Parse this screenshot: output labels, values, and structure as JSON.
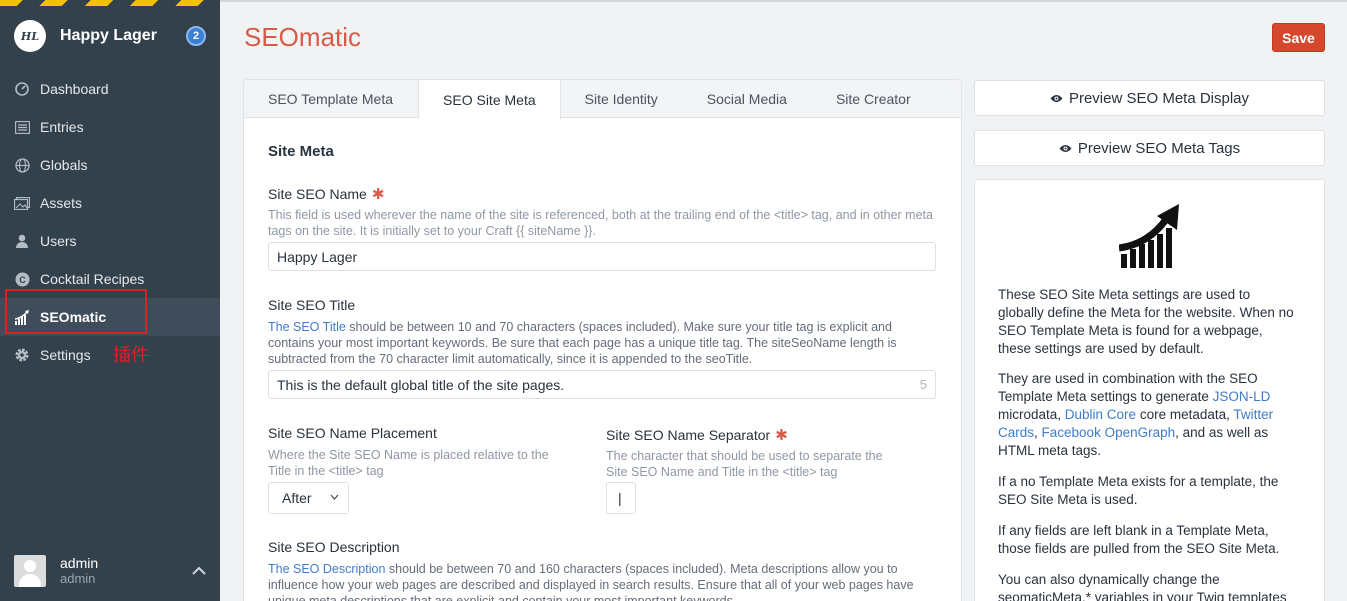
{
  "sidebar": {
    "site_logo": "HL",
    "site_name": "Happy Lager",
    "badge": "2",
    "items": [
      {
        "label": "Dashboard",
        "icon": "dashboard-icon"
      },
      {
        "label": "Entries",
        "icon": "entries-icon"
      },
      {
        "label": "Globals",
        "icon": "globe-icon"
      },
      {
        "label": "Assets",
        "icon": "assets-icon"
      },
      {
        "label": "Users",
        "icon": "users-icon"
      },
      {
        "label": "Cocktail Recipes",
        "icon": "plugin-c-icon"
      },
      {
        "label": "SEOmatic",
        "icon": "seomatic-chart-icon",
        "active": true
      },
      {
        "label": "Settings",
        "icon": "gear-icon"
      }
    ],
    "annotation": "插件",
    "user": {
      "name": "admin",
      "username": "admin"
    }
  },
  "header": {
    "title": "SEOmatic",
    "save_label": "Save",
    "save_color": "#d6482e"
  },
  "tabs": [
    "SEO Template Meta",
    "SEO Site Meta",
    "Site Identity",
    "Social Media",
    "Site Creator"
  ],
  "active_tab": "SEO Site Meta",
  "form": {
    "section_title": "Site Meta",
    "site_seo_name": {
      "label": "Site SEO Name",
      "instructions": "This field is used wherever the name of the site is referenced, both at the trailing end of the <title> tag, and in other meta tags on the site. It is initially set to your Craft {{ siteName }}.",
      "value": "Happy Lager"
    },
    "site_seo_title": {
      "label": "Site SEO Title",
      "link_text": "The SEO Title",
      "instructions": " should be between 10 and 70 characters (spaces included). Make sure your title tag is explicit and contains your most important keywords. Be sure that each page has a unique title tag. The siteSeoName length is subtracted from the 70 character limit automatically, since it is appended to the seoTitle.",
      "value": "This is the default global title of the site pages.",
      "counter": "5"
    },
    "placement": {
      "label": "Site SEO Name Placement",
      "instructions": "Where the Site SEO Name is placed relative to the Title in the <title> tag",
      "value": "After"
    },
    "separator": {
      "label": "Site SEO Name Separator",
      "instructions": "The character that should be used to separate the Site SEO Name and Title in the <title> tag",
      "value": "|"
    },
    "description": {
      "label": "Site SEO Description",
      "link_text": "The SEO Description",
      "instructions": " should be between 70 and 160 characters (spaces included). Meta descriptions allow you to influence how your web pages are described and displayed in search results. Ensure that all of your web pages have unique meta descriptions that are explicit and contain your most important keywords."
    }
  },
  "preview": {
    "display_label": "Preview SEO Meta Display",
    "tags_label": "Preview SEO Meta Tags"
  },
  "info": {
    "p1": "These SEO Site Meta settings are used to globally define the Meta for the website. When no SEO Template Meta is found for a webpage, these settings are used by default.",
    "p2_a": "They are used in combination with the SEO Template Meta settings to generate ",
    "p2_link1": "JSON-LD",
    "p2_b": " microdata, ",
    "p2_link2": "Dublin Core",
    "p2_c": " core metadata, ",
    "p2_link3": "Twitter Cards",
    "p2_d": ", ",
    "p2_link4": "Facebook OpenGraph",
    "p2_e": ", and as well as HTML meta tags.",
    "p3": "If a no Template Meta exists for a template, the SEO Site Meta is used.",
    "p4": "If any fields are left blank in a Template Meta, those fields are pulled from the SEO Site Meta.",
    "p5": "You can also dynamically change the seomaticMeta.* variables in your Twig templates"
  }
}
